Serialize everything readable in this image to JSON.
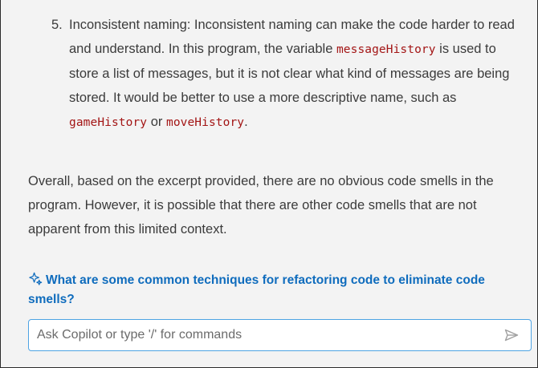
{
  "response": {
    "list_item": {
      "number": "5.",
      "text_1": "Inconsistent naming: Inconsistent naming can make the code harder to read and understand. In this program, the variable ",
      "code_1": "messageHistory",
      "text_2": " is used to store a list of messages, but it is not clear what kind of messages are being stored. It would be better to use a more descriptive name, such as ",
      "code_2": "gameHistory",
      "text_3": " or ",
      "code_3": "moveHistory",
      "text_4": "."
    },
    "summary": "Overall, based on the excerpt provided, there are no obvious code smells in the program. However, it is possible that there are other code smells that are not apparent from this limited context."
  },
  "suggestion": {
    "icon": "sparkle-icon",
    "label": "What are some common techniques for refactoring code to eliminate code smells?"
  },
  "chat_input": {
    "placeholder": "Ask Copilot or type '/' for commands",
    "value": "",
    "send_icon": "send-icon"
  },
  "colors": {
    "panel_bg": "#f3f3f3",
    "text": "#3b3b3b",
    "code": "#a31515",
    "link": "#0f6cbd",
    "input_border": "#4da3e3"
  }
}
